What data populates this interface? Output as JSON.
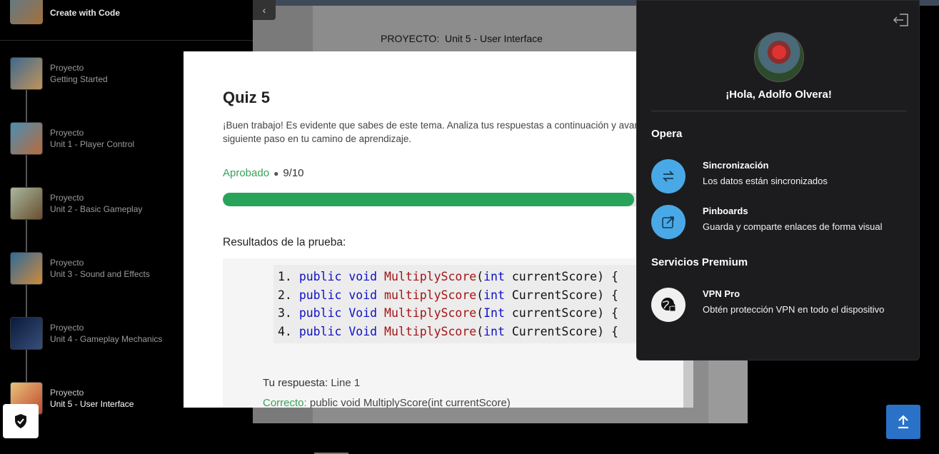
{
  "sidebar": {
    "header_title": "Create with Code",
    "items": [
      {
        "line1": "Proyecto",
        "line2": "Getting Started"
      },
      {
        "line1": "Proyecto",
        "line2": "Unit 1 - Player Control"
      },
      {
        "line1": "Proyecto",
        "line2": "Unit 2 - Basic Gameplay"
      },
      {
        "line1": "Proyecto",
        "line2": "Unit 3 - Sound and Effects"
      },
      {
        "line1": "Proyecto",
        "line2": "Unit 4 - Gameplay Mechanics"
      },
      {
        "line1": "Proyecto",
        "line2": "Unit 5 - User Interface"
      }
    ]
  },
  "page": {
    "back_icon": "chevron-left-icon",
    "proyecto_label": "PROYECTO:",
    "proyecto_name": "Unit 5 - User Interface"
  },
  "quiz": {
    "title": "Quiz 5",
    "description": "¡Buen trabajo! Es evidente que sabes de este tema. Analiza tus respuestas a continuación y avanza al siguiente paso en tu camino de aprendizaje.",
    "status": "Aprobado",
    "score": "9/10",
    "progress_fraction": 0.9,
    "results_label": "Resultados de la prueba:",
    "code_lines": [
      "1. public void MultiplyScore(int currentScore) {",
      "2. public void multiplyScore(int CurrentScore) {",
      "3. public Void MultiplyScore(Int currentScore) {",
      "4. public Void MultiplyScore(int CurrentScore) {"
    ],
    "your_answer_label": "Tu respuesta:",
    "your_answer_value": "Line 1",
    "correct_label": "Correcto:",
    "correct_value": "public void MultiplyScore(int currentScore)"
  },
  "opera_panel": {
    "greeting": "¡Hola, Adolfo Olvera!",
    "section_opera": "Opera",
    "section_premium": "Servicios Premium",
    "items": [
      {
        "title": "Sincronización",
        "subtitle": "Los datos están sincronizados",
        "icon": "sync-icon"
      },
      {
        "title": "Pinboards",
        "subtitle": "Guarda y comparte enlaces de forma visual",
        "icon": "pinboard-icon"
      },
      {
        "title": "VPN Pro",
        "subtitle": "Obtén protección VPN en todo el dispositivo",
        "icon": "vpn-globe-icon"
      }
    ]
  },
  "colors": {
    "accent_blue": "#49a9e6",
    "success_green": "#28a45a",
    "scroll_button": "#2a72c8"
  }
}
